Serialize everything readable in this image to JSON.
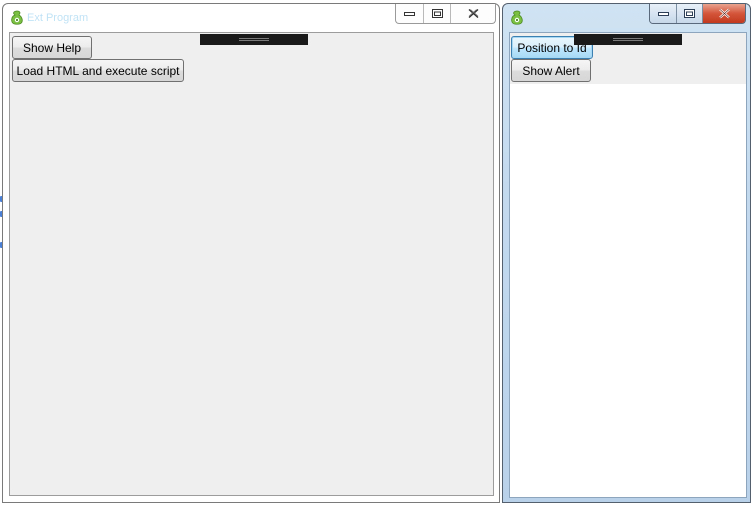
{
  "desktop": {
    "accent_color": "#4a7fd6"
  },
  "window_left": {
    "title": "Ext Program",
    "icon": "app-icon",
    "caption_buttons": {
      "minimize": "minimize-icon",
      "maximize": "maximize-icon",
      "close": "close-icon"
    },
    "buttons": {
      "show_help": "Show Help",
      "load_html": "Load HTML and execute script"
    },
    "client_background": "#efefef"
  },
  "window_right": {
    "title": "",
    "icon": "app-icon",
    "caption_buttons": {
      "minimize": "minimize-icon",
      "maximize": "maximize-icon",
      "close": "close-icon"
    },
    "close_button_color": "#c23a1f",
    "buttons": {
      "position_to_id": "Position to Id",
      "show_alert": "Show Alert"
    },
    "content_background": "#ffffff"
  }
}
